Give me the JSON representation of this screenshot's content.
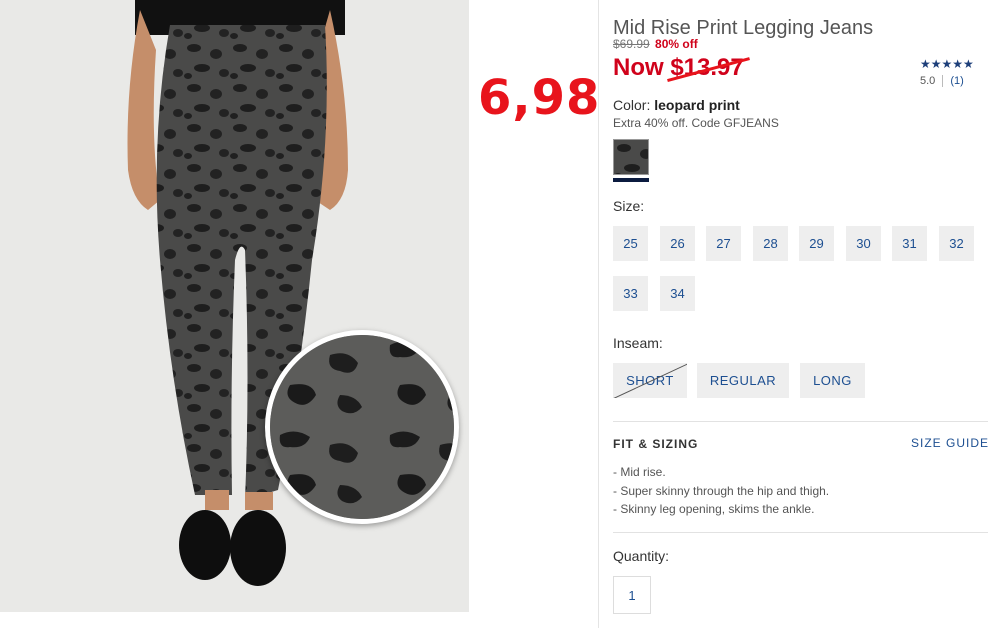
{
  "annotation": "6,98",
  "product": {
    "title": "Mid Rise Print Legging Jeans",
    "original_price": "$69.99",
    "discount": "80% off",
    "now_prefix": "Now ",
    "now_price": "$13.97",
    "rating": {
      "stars": "★★★★★",
      "score": "5.0",
      "count": "(1)"
    },
    "color_label": "Color: ",
    "color_value": "leopard print",
    "promo": "Extra 40% off. Code GFJEANS"
  },
  "size": {
    "label": "Size:",
    "options": [
      "25",
      "26",
      "27",
      "28",
      "29",
      "30",
      "31",
      "32",
      "33",
      "34"
    ]
  },
  "inseam": {
    "label": "Inseam:",
    "options": [
      "SHORT",
      "REGULAR",
      "LONG"
    ],
    "disabled": [
      "SHORT"
    ]
  },
  "fit": {
    "heading": "FIT & SIZING",
    "size_guide": "SIZE GUIDE",
    "items": [
      "- Mid rise.",
      "- Super skinny through the hip and thigh.",
      "- Skinny leg opening, skims the ankle."
    ]
  },
  "quantity": {
    "label": "Quantity:",
    "value": "1"
  },
  "colors": {
    "sale_red": "#d0021b",
    "link_blue": "#1d4f91",
    "annotation_red": "#e8141c"
  }
}
